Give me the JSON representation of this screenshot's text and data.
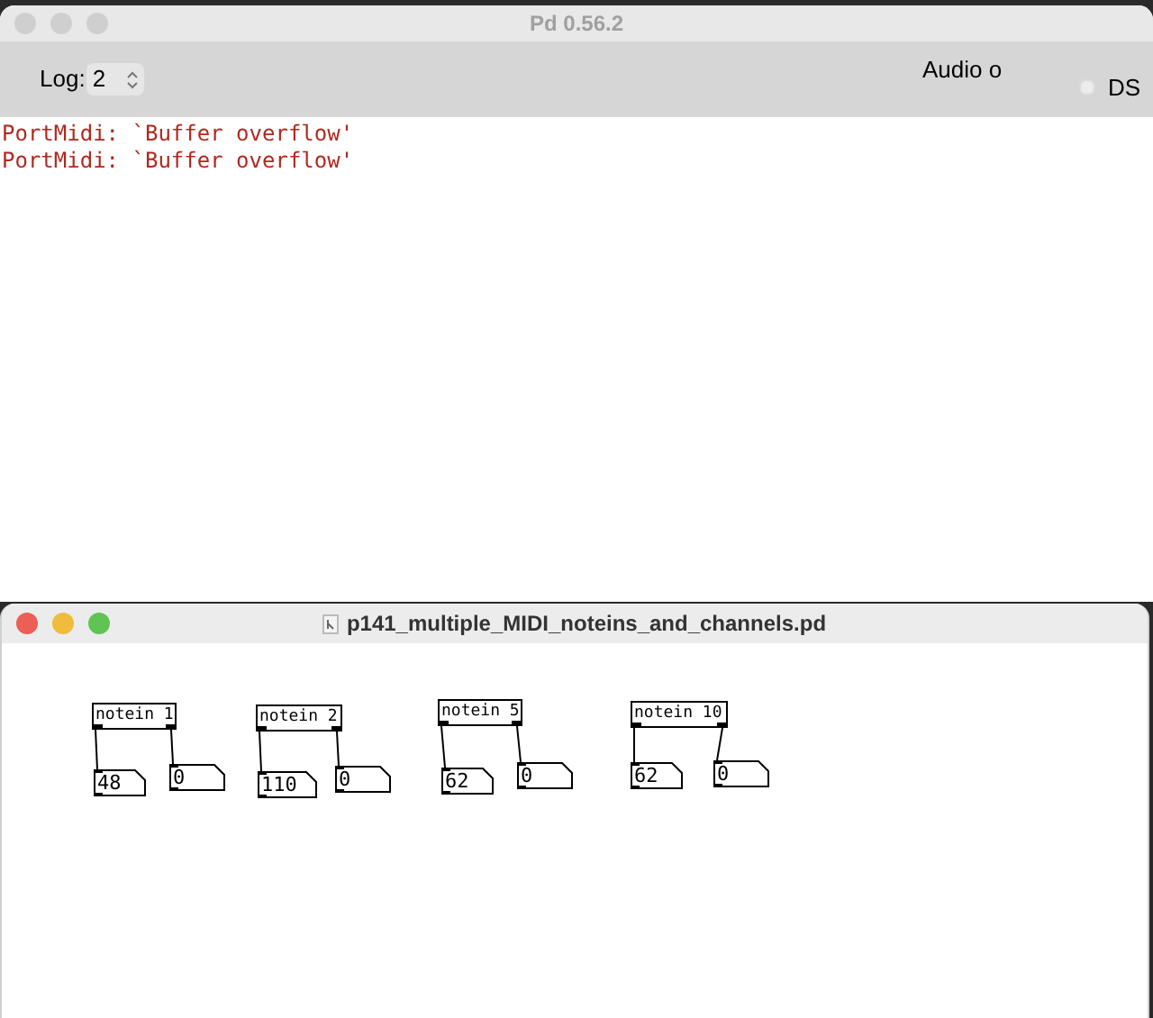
{
  "main_window": {
    "title": "Pd 0.56.2",
    "log_label": "Log:",
    "log_level": "2",
    "audio_status": "Audio o",
    "dsp": {
      "label": "DS",
      "checked": false
    },
    "messages": [
      "PortMidi: `Buffer overflow'",
      "PortMidi: `Buffer overflow'"
    ]
  },
  "patch_window": {
    "title": "p141_multiple_MIDI_noteins_and_channels.pd",
    "patches": [
      {
        "object": "notein 1",
        "note": "48",
        "velocity": "0"
      },
      {
        "object": "notein 2",
        "note": "110",
        "velocity": "0"
      },
      {
        "object": "notein 5",
        "note": "62",
        "velocity": "0"
      },
      {
        "object": "notein 10",
        "note": "62",
        "velocity": "0"
      }
    ]
  }
}
